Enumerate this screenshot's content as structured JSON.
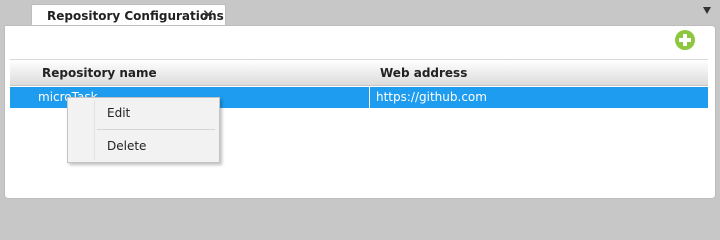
{
  "tab": {
    "label": "Repository Configurations",
    "close_glyph": "✕"
  },
  "toolbar": {
    "add_icon": "plus-circle-icon",
    "add_color": "#8dc63f"
  },
  "grid": {
    "columns": [
      "Repository name",
      "Web address"
    ],
    "rows": [
      {
        "name": "microTask",
        "web_address": "https://github.com"
      }
    ],
    "selected_row_color": "#1e9cf0"
  },
  "context_menu": {
    "items": [
      "Edit",
      "Delete"
    ]
  }
}
